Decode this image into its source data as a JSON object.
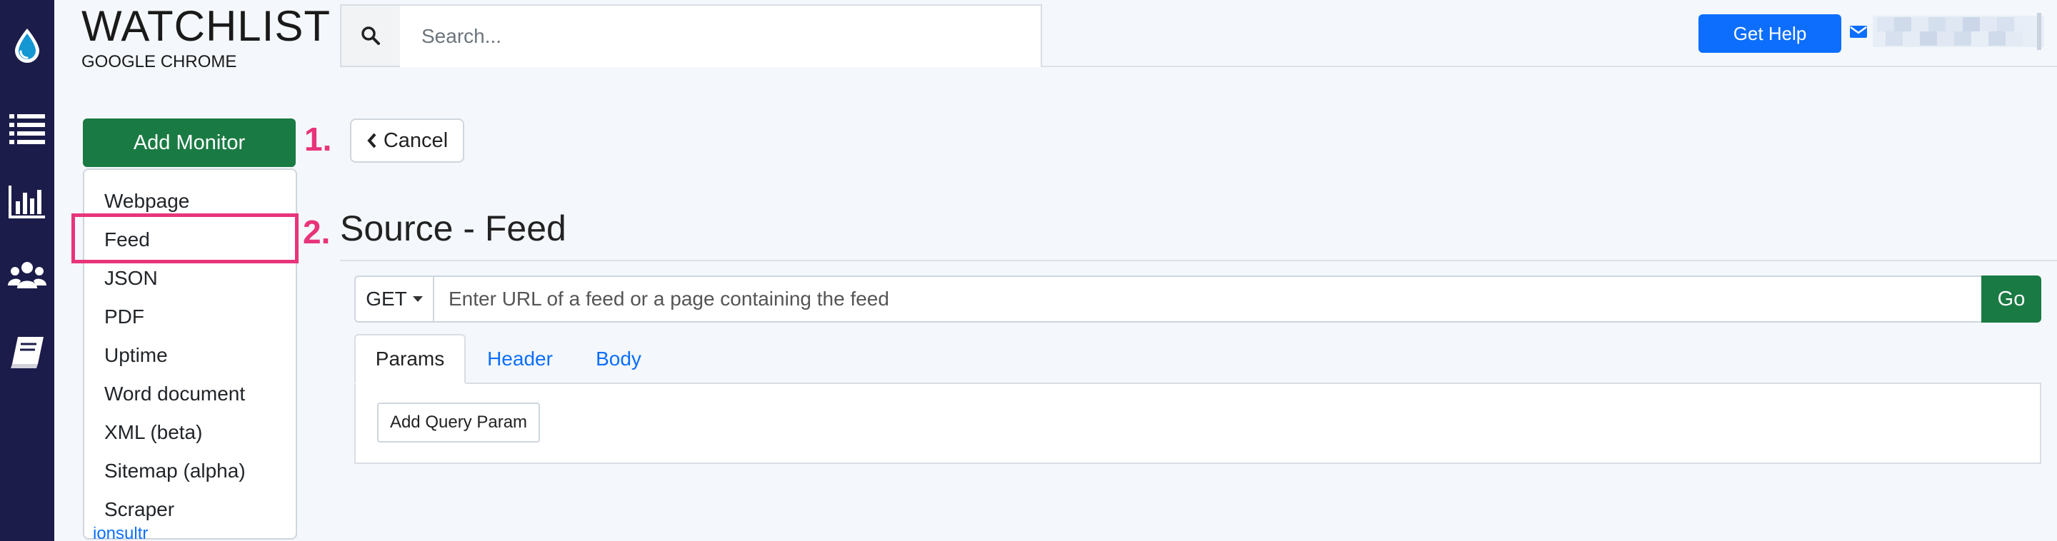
{
  "app": {
    "title": "WATCHLIST",
    "subtitle": "GOOGLE CHROME"
  },
  "sidebar": {
    "items": [
      {
        "icon": "drop-logo-icon"
      },
      {
        "icon": "list-icon"
      },
      {
        "icon": "bar-chart-icon"
      },
      {
        "icon": "users-icon"
      },
      {
        "icon": "book-icon"
      }
    ]
  },
  "search": {
    "placeholder": "Search..."
  },
  "header": {
    "get_help": "Get Help",
    "mail_icon": "envelope-icon"
  },
  "toolbar": {
    "add_monitor": "Add Monitor",
    "cancel": "Cancel"
  },
  "annotations": {
    "step1": "1.",
    "step2": "2."
  },
  "dropdown": {
    "items": [
      "Webpage",
      "Feed",
      "JSON",
      "PDF",
      "Uptime",
      "Word document",
      "XML (beta)",
      "Sitemap (alpha)",
      "Scraper"
    ],
    "highlighted": "Feed"
  },
  "peek_text": "ionsultr",
  "main": {
    "section_title": "Source - Feed",
    "method": "GET",
    "url_placeholder": "Enter URL of a feed or a page containing the feed",
    "go": "Go",
    "tabs": [
      "Params",
      "Header",
      "Body"
    ],
    "add_query_param": "Add Query Param"
  },
  "colors": {
    "sidebar": "#1c1c4a",
    "primary_green": "#1a7a43",
    "primary_blue": "#0d6efd",
    "annotation_pink": "#e8347a",
    "page_background": "#f4f8fc"
  }
}
